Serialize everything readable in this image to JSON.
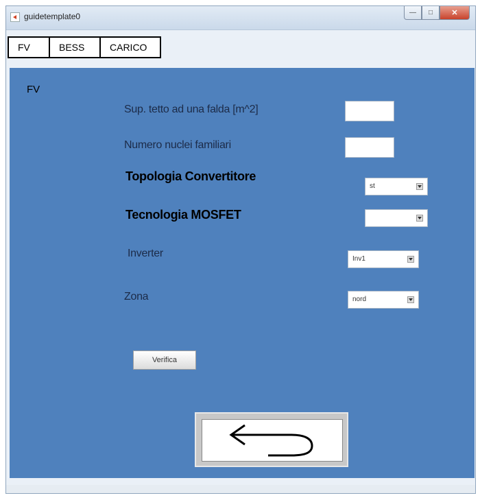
{
  "window": {
    "title": "guidetemplate0"
  },
  "toolbar": {
    "tabs": [
      "FV",
      "BESS",
      "CARICO"
    ]
  },
  "panel": {
    "title": "FV",
    "fields": {
      "sup_label": "Sup. tetto ad una falda [m^2]",
      "sup_value": "",
      "nuclei_label": "Numero nuclei familiari",
      "nuclei_value": "",
      "topologia_label": "Topologia Convertitore",
      "topologia_value": "st",
      "tecnologia_label": "Tecnologia MOSFET",
      "tecnologia_value": "",
      "inverter_label": "Inverter",
      "inverter_value": "Inv1",
      "zona_label": "Zona",
      "zona_value": "nord"
    },
    "verifica_label": "Verifica"
  },
  "colors": {
    "panel_bg": "#4f81bd",
    "window_bg": "#eaf0f7"
  },
  "icons": {
    "back": "back-arrow-icon",
    "app": "matlab-figure-icon"
  }
}
